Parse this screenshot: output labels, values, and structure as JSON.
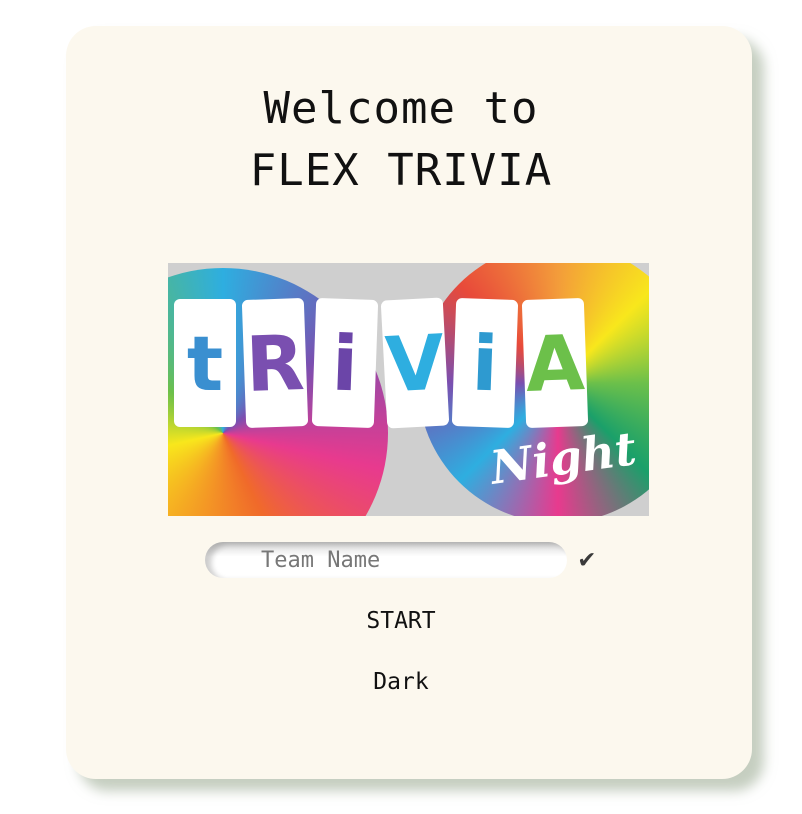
{
  "header": {
    "title_line1": "Welcome to",
    "title_line2": "FLEX TRIVIA"
  },
  "banner": {
    "letters": [
      "t",
      "R",
      "i",
      "V",
      "i",
      "A"
    ],
    "subtitle": "Night"
  },
  "form": {
    "team_placeholder": "Team Name",
    "team_value": "",
    "submit_icon": "check-icon",
    "submit_glyph": "✔"
  },
  "buttons": {
    "start": "START",
    "theme": "Dark"
  }
}
